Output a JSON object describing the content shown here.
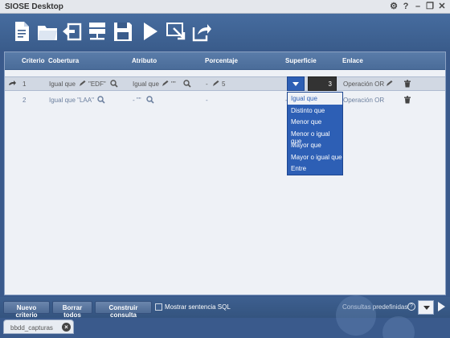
{
  "app": {
    "title": "SIOSE Desktop"
  },
  "window_controls": [
    "settings-icon",
    "help-icon",
    "minimize-icon",
    "maximize-icon",
    "close-icon"
  ],
  "toolbar": {
    "buttons": [
      "new-document-icon",
      "open-folder-icon",
      "back-import-icon",
      "database-icon",
      "save-icon",
      "play-icon",
      "select-export-icon",
      "share-export-icon"
    ]
  },
  "table": {
    "columns": [
      "Criterio",
      "Cobertura",
      "Atributo",
      "Porcentaje",
      "Superficie",
      "Enlace"
    ],
    "rows": [
      {
        "criterio": "1",
        "cobertura": "Igual que",
        "cobertura_value": "\"EDF\"",
        "atributo": "Igual que",
        "atributo_value": "\"\"",
        "porcentaje_op": "-",
        "porcentaje": "5",
        "superficie_value": "3",
        "enlace": "Operación OR"
      },
      {
        "criterio": "2",
        "cobertura": "Igual que \"LAA\"",
        "atributo": "- \"\"",
        "porcentaje": "-",
        "superficie": "-",
        "enlace": "Operación OR"
      }
    ]
  },
  "dropdown": {
    "options": [
      "Igual que",
      "Distinto que",
      "Menor que",
      "Menor o igual que",
      "Mayor que",
      "Mayor o igual que",
      "Entre"
    ],
    "selected_index": 0
  },
  "bottom": {
    "nuevo_criterio": "Nuevo criterio",
    "borrar_todos": "Borrar todos",
    "construir_consulta": "Construir consulta",
    "mostrar_sql": "Mostrar sentencia SQL",
    "consultas_predefinidas": "Consultas predefinidas:",
    "help": "?"
  },
  "tabs": [
    {
      "label": "bbdd_capturas"
    }
  ],
  "colors": {
    "accent": "#2d5fb5",
    "header": "#4a6c99",
    "background": "#3a5a8c"
  }
}
